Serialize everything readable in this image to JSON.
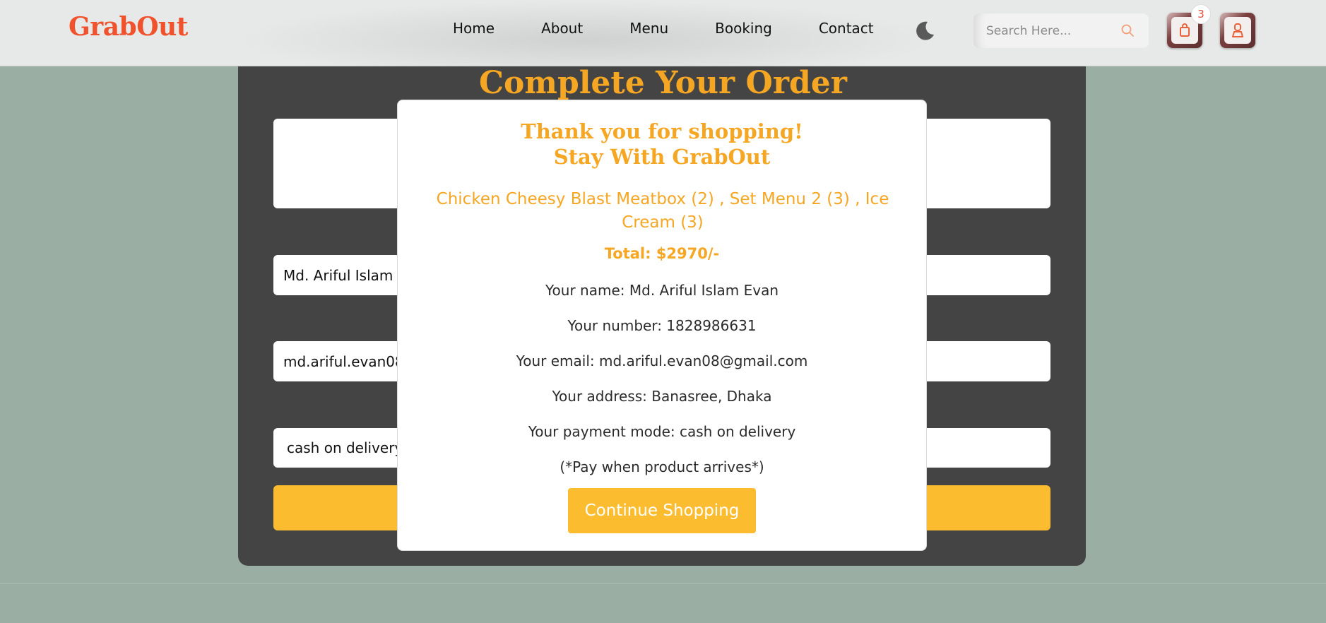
{
  "header": {
    "logo": "GrabOut",
    "nav": [
      "Home",
      "About",
      "Menu",
      "Booking",
      "Contact"
    ],
    "search_placeholder": "Search Here...",
    "cart_count": "3",
    "icons": {
      "theme": "moon-icon",
      "search": "search-icon",
      "cart": "shopping-bag-icon",
      "user": "user-icon"
    }
  },
  "form": {
    "title": "Complete Your Order",
    "items_value": "",
    "name_value": "Md. Ariful Islam Evan",
    "email_value": "md.ariful.evan08@gmail.com",
    "payment_value": "cash on delivery"
  },
  "modal": {
    "title_line1": "Thank you for shopping!",
    "title_line2": "Stay With GrabOut",
    "items": "Chicken Cheesy Blast Meatbox (2) , Set Menu 2 (3) , Ice Cream (3)",
    "total": "Total: $2970/-",
    "name_line": "Your name: Md. Ariful Islam Evan",
    "number_line": "Your number: 1828986631",
    "email_line": "Your email: md.ariful.evan08@gmail.com",
    "address_line": "Your address: Banasree, Dhaka",
    "payment_line": "Your payment mode: cash on delivery",
    "note_line": "(*Pay when product arrives*)",
    "continue_label": "Continue Shopping"
  },
  "colors": {
    "accent": "#f5a623",
    "button": "#fbbd2f",
    "logo": "#f0522d",
    "background": "#9aaea4",
    "panel": "#444444"
  }
}
